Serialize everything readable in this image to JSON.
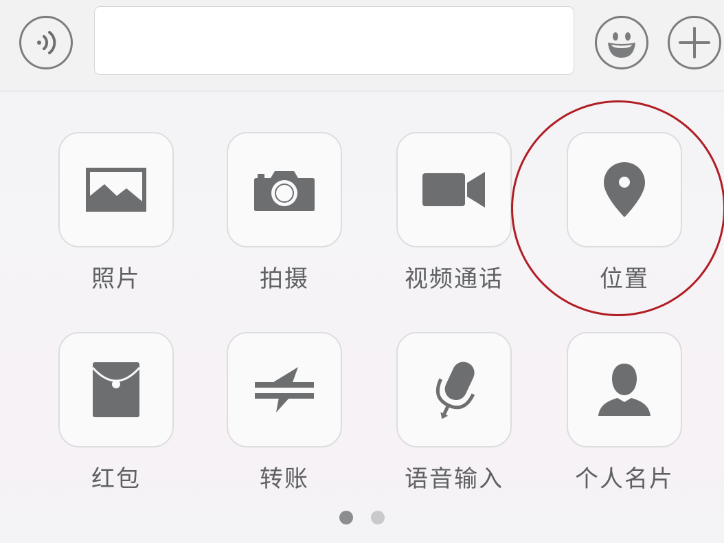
{
  "input_bar": {
    "voice_icon": "voice-icon",
    "emoji_icon": "smiley-icon",
    "more_icon": "plus-icon",
    "text_value": ""
  },
  "panel": {
    "items": [
      {
        "label": "照片",
        "icon": "photo-icon"
      },
      {
        "label": "拍摄",
        "icon": "camera-icon"
      },
      {
        "label": "视频通话",
        "icon": "video-call-icon"
      },
      {
        "label": "位置",
        "icon": "location-pin-icon"
      },
      {
        "label": "红包",
        "icon": "red-packet-icon"
      },
      {
        "label": "转账",
        "icon": "transfer-icon"
      },
      {
        "label": "语音输入",
        "icon": "microphone-icon"
      },
      {
        "label": "个人名片",
        "icon": "contact-card-icon"
      }
    ],
    "highlighted_item": "位置",
    "highlight_color": "#b01e24"
  },
  "pager": {
    "page_count": 2,
    "current_page": 1
  },
  "colors": {
    "icon": "#6d6e70",
    "label": "#5f6062"
  }
}
